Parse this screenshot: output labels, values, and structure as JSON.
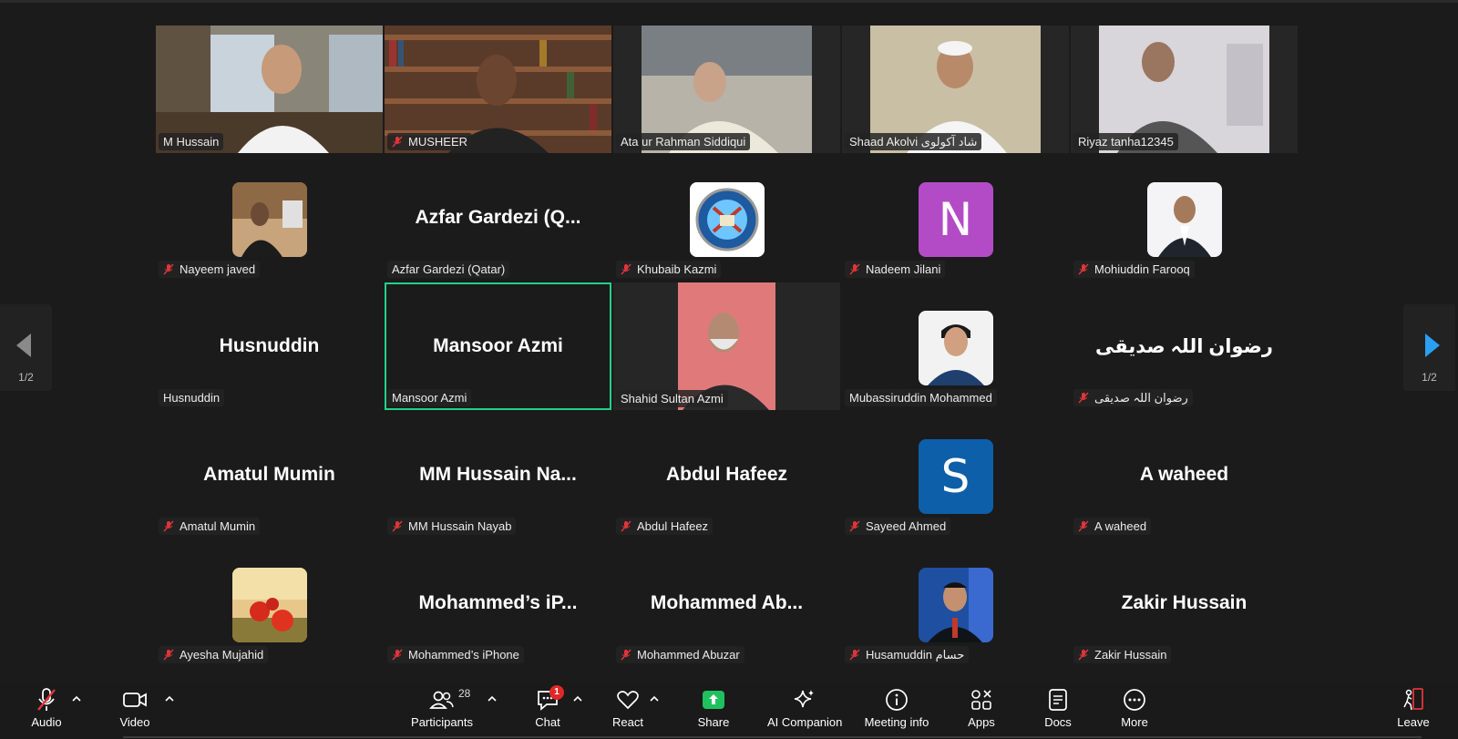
{
  "participants_grid": {
    "row1": [
      {
        "name": "M Hussain"
      },
      {
        "name": "MUSHEER"
      },
      {
        "name": "Ata ur Rahman Siddiqui"
      },
      {
        "name": "Shaad Akolvi  شاد آکولوی"
      },
      {
        "name": "Riyaz tanha12345"
      }
    ],
    "row2": [
      {
        "label": "Nayeem javed"
      },
      {
        "label": "Azfar Gardezi (Qatar)",
        "display": "Azfar Gardezi (Q..."
      },
      {
        "label": "Khubaib Kazmi"
      },
      {
        "label": "Nadeem Jilani",
        "initial": "N",
        "color": "#b44bc6"
      },
      {
        "label": "Mohiuddin Farooq"
      }
    ],
    "row3": [
      {
        "label": "Husnuddin",
        "display": "Husnuddin"
      },
      {
        "label": "Mansoor Azmi",
        "display": "Mansoor Azmi"
      },
      {
        "label": "Shahid Sultan Azmi"
      },
      {
        "label": "Mubassiruddin Mohammed"
      },
      {
        "label": "رضوان اللہ صدیقی",
        "display": "رضوان اللہ صدیقی"
      }
    ],
    "row4": [
      {
        "label": "Amatul Mumin",
        "display": "Amatul Mumin"
      },
      {
        "label": "MM Hussain Nayab",
        "display": "MM Hussain Na..."
      },
      {
        "label": "Abdul Hafeez",
        "display": "Abdul Hafeez"
      },
      {
        "label": "Sayeed Ahmed",
        "initial": "S",
        "color": "#0c5fa8"
      },
      {
        "label": "A waheed",
        "display": "A waheed"
      }
    ],
    "row5": [
      {
        "label": "Ayesha Mujahid"
      },
      {
        "label": "Mohammed’s iPhone",
        "display": "Mohammed’s iP..."
      },
      {
        "label": "Mohammed Abuzar",
        "display": "Mohammed Ab..."
      },
      {
        "label": "Husamuddin حسام"
      },
      {
        "label": "Zakir Hussain",
        "display": "Zakir Hussain"
      }
    ]
  },
  "pager": {
    "left_page": "1/2",
    "right_page": "1/2"
  },
  "toolbar": {
    "audio": "Audio",
    "video": "Video",
    "participants": "Participants",
    "participants_count": "28",
    "chat": "Chat",
    "chat_badge": "1",
    "react": "React",
    "share": "Share",
    "ai_companion": "AI Companion",
    "meeting_info": "Meeting info",
    "apps": "Apps",
    "docs": "Docs",
    "more": "More",
    "leave": "Leave"
  },
  "colors": {
    "active_speaker_border": "#23d18b",
    "share_green": "#1fc15f",
    "muted_red": "#e0353b",
    "pager_arrow_active": "#2aa0f5"
  }
}
